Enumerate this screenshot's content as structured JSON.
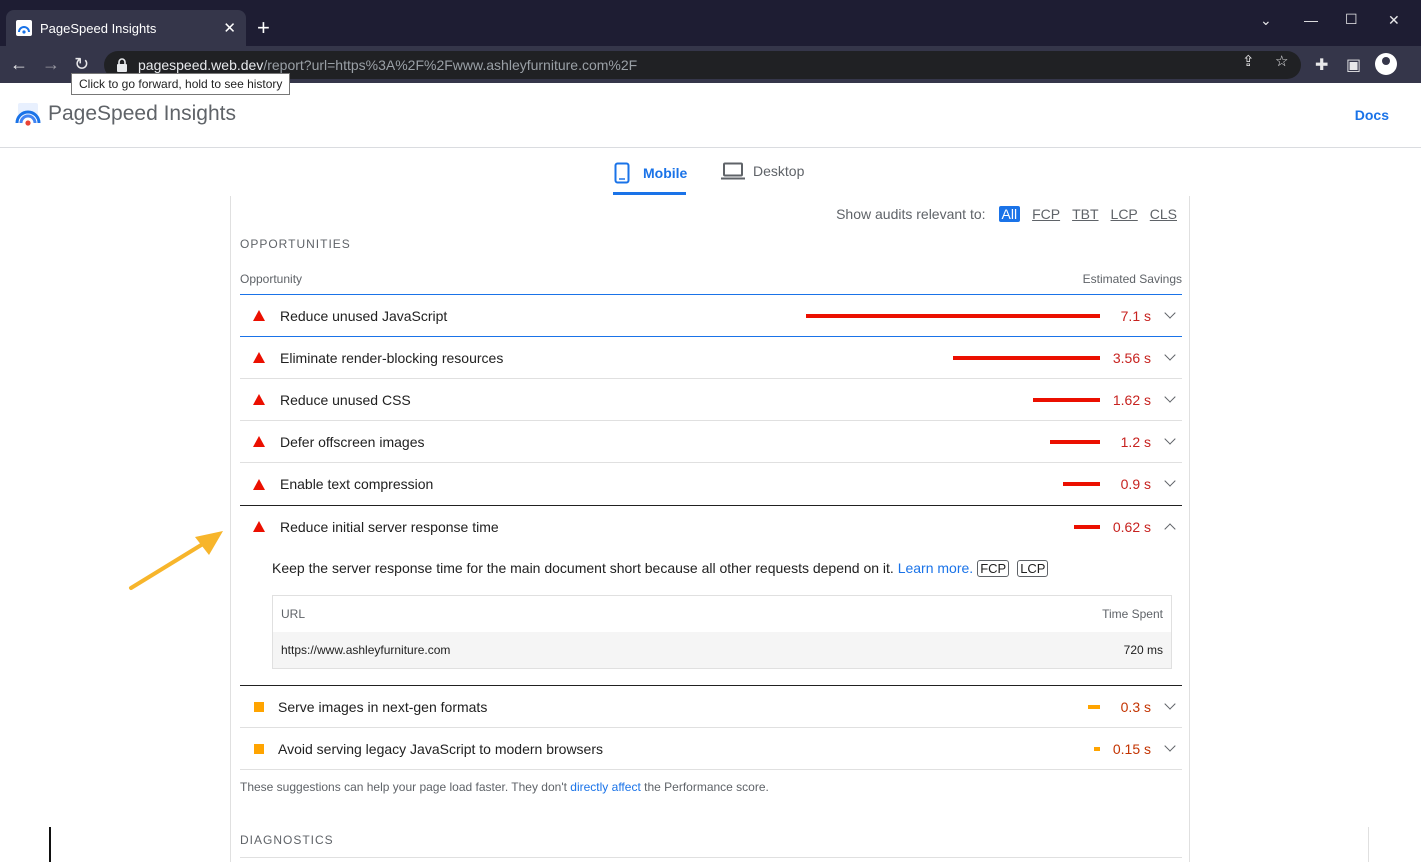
{
  "browser": {
    "tab_title": "PageSpeed Insights",
    "url_host": "pagespeed.web.dev",
    "url_path": "/report?url=https%3A%2F%2Fwww.ashleyfurniture.com%2F",
    "tooltip": "Click to go forward, hold to see history"
  },
  "header": {
    "title": "PageSpeed Insights",
    "docs": "Docs"
  },
  "device_tabs": {
    "mobile": "Mobile",
    "desktop": "Desktop"
  },
  "filter": {
    "label": "Show audits relevant to:",
    "chips": [
      "All",
      "FCP",
      "TBT",
      "LCP",
      "CLS"
    ]
  },
  "opportunities": {
    "section_title": "OPPORTUNITIES",
    "col_opportunity": "Opportunity",
    "col_savings": "Estimated Savings",
    "items": [
      {
        "label": "Reduce unused JavaScript",
        "savings": "7.1 s",
        "value_s": 7.1,
        "severity": "fail"
      },
      {
        "label": "Eliminate render-blocking resources",
        "savings": "3.56 s",
        "value_s": 3.56,
        "severity": "fail"
      },
      {
        "label": "Reduce unused CSS",
        "savings": "1.62 s",
        "value_s": 1.62,
        "severity": "fail"
      },
      {
        "label": "Defer offscreen images",
        "savings": "1.2 s",
        "value_s": 1.2,
        "severity": "fail"
      },
      {
        "label": "Enable text compression",
        "savings": "0.9 s",
        "value_s": 0.9,
        "severity": "fail"
      },
      {
        "label": "Reduce initial server response time",
        "savings": "0.62 s",
        "value_s": 0.62,
        "severity": "fail"
      },
      {
        "label": "Serve images in next-gen formats",
        "savings": "0.3 s",
        "value_s": 0.3,
        "severity": "average"
      },
      {
        "label": "Avoid serving legacy JavaScript to modern browsers",
        "savings": "0.15 s",
        "value_s": 0.15,
        "severity": "average"
      }
    ],
    "expanded": {
      "description": "Keep the server response time for the main document short because all other requests depend on it.",
      "learn_more": "Learn more.",
      "tags": [
        "FCP",
        "LCP"
      ],
      "table_col_url": "URL",
      "table_col_time": "Time Spent",
      "row_url": "https://www.ashleyfurniture.com",
      "row_time": "720 ms"
    },
    "footnote_pre": "These suggestions can help your page load faster. They don't",
    "footnote_link": "directly affect",
    "footnote_post": "the Performance score."
  },
  "diagnostics": {
    "section_title": "DIAGNOSTICS"
  },
  "colors": {
    "accent": "#1a73e8",
    "fail": "#eb0f00",
    "average": "#ffa400",
    "arrow": "#f7b52b"
  }
}
